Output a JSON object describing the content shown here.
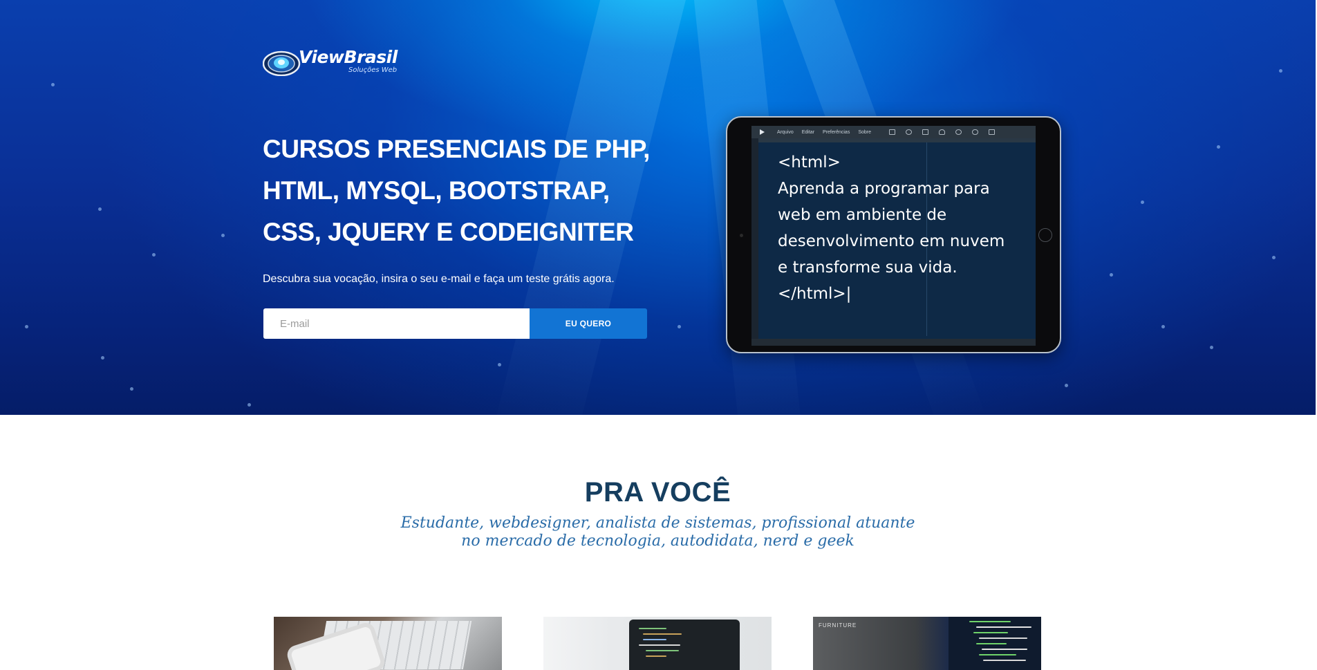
{
  "brand": {
    "name": "ViewBrasil",
    "tagline": "Soluções Web"
  },
  "hero": {
    "headline_lines": [
      "CURSOS PRESENCIAIS DE PHP,",
      "HTML, MYSQL, BOOTSTRAP,",
      "CSS, JQUERY E CODEIGNITER"
    ],
    "subtext": "Descubra sua vocação, insira o seu e-mail e faça um teste grátis agora.",
    "email": {
      "placeholder": "E-mail",
      "value": ""
    },
    "cta_label": "EU QUERO"
  },
  "editor": {
    "menu": [
      "Arquivo",
      "Editar",
      "Preferências",
      "Sobre"
    ],
    "toolbar_icons": [
      "grid-icon",
      "search-icon",
      "list-icon",
      "user-icon",
      "refresh-icon",
      "cloud-icon",
      "image-icon"
    ],
    "code_lines": [
      "<html>",
      "Aprenda a programar para",
      "web em ambiente de",
      "desenvolvimento em nuvem",
      "e transforme sua vida.",
      "</html>|"
    ]
  },
  "section": {
    "title": "PRA VOCÊ",
    "subtitle_lines": [
      "Estudante, webdesigner, analista de sistemas, profissional atuante",
      "no mercado de tecnologia, autodidata, nerd e geek"
    ]
  },
  "cards": {
    "card3_label": "FURNITURE"
  },
  "colors": {
    "hero_top": "#00b4f0",
    "hero_bottom": "#06237a",
    "cta": "#1274d4",
    "section_title": "#153e5f",
    "section_subtitle": "#2a6ca8"
  }
}
